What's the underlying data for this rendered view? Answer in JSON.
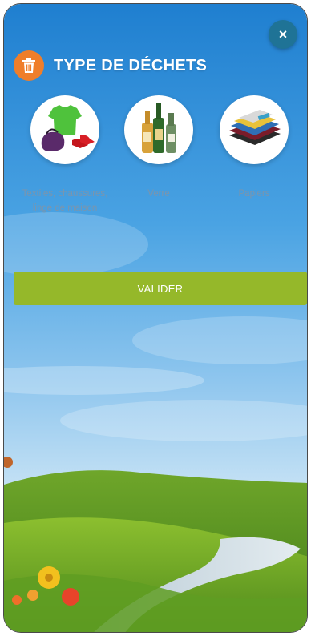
{
  "header": {
    "title": "TYPE DE DÉCHETS",
    "icon": "trash-icon",
    "icon_color": "#ef7e2a"
  },
  "close_button": {
    "label": "×",
    "color": "#1f7396"
  },
  "categories": [
    {
      "label": "Textiles, chaussures, linge de maison",
      "icon": "clothes-icon"
    },
    {
      "label": "Verre",
      "icon": "bottles-icon"
    },
    {
      "label": "Papiers",
      "icon": "papers-icon"
    }
  ],
  "validate_button": {
    "label": "VALIDER",
    "color": "#95b82a"
  }
}
